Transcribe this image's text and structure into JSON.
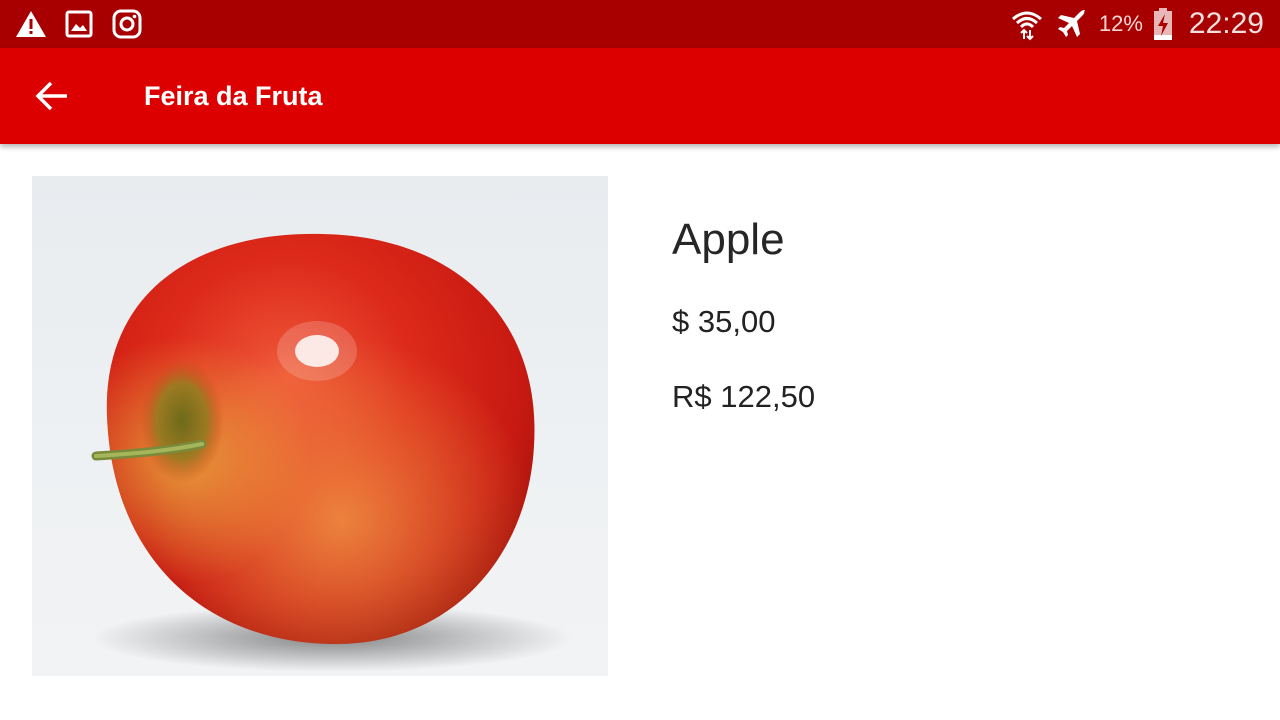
{
  "status_bar": {
    "left_icons": [
      "warning-icon",
      "gallery-icon",
      "instagram-icon"
    ],
    "right_icons": [
      "wifi-icon",
      "airplane-mode-icon",
      "battery-charging-icon"
    ],
    "battery": "12%",
    "time": "22:29"
  },
  "app_bar": {
    "back_icon": "arrow-left-icon",
    "title": "Feira da Fruta",
    "color": "#dd0000"
  },
  "product": {
    "image": "apple-photo",
    "name": "Apple",
    "price_usd": "$ 35,00",
    "price_brl": "R$ 122,50"
  },
  "colors": {
    "status_bar": "#a80000",
    "app_bar": "#dd0000",
    "background": "#ffffff"
  }
}
